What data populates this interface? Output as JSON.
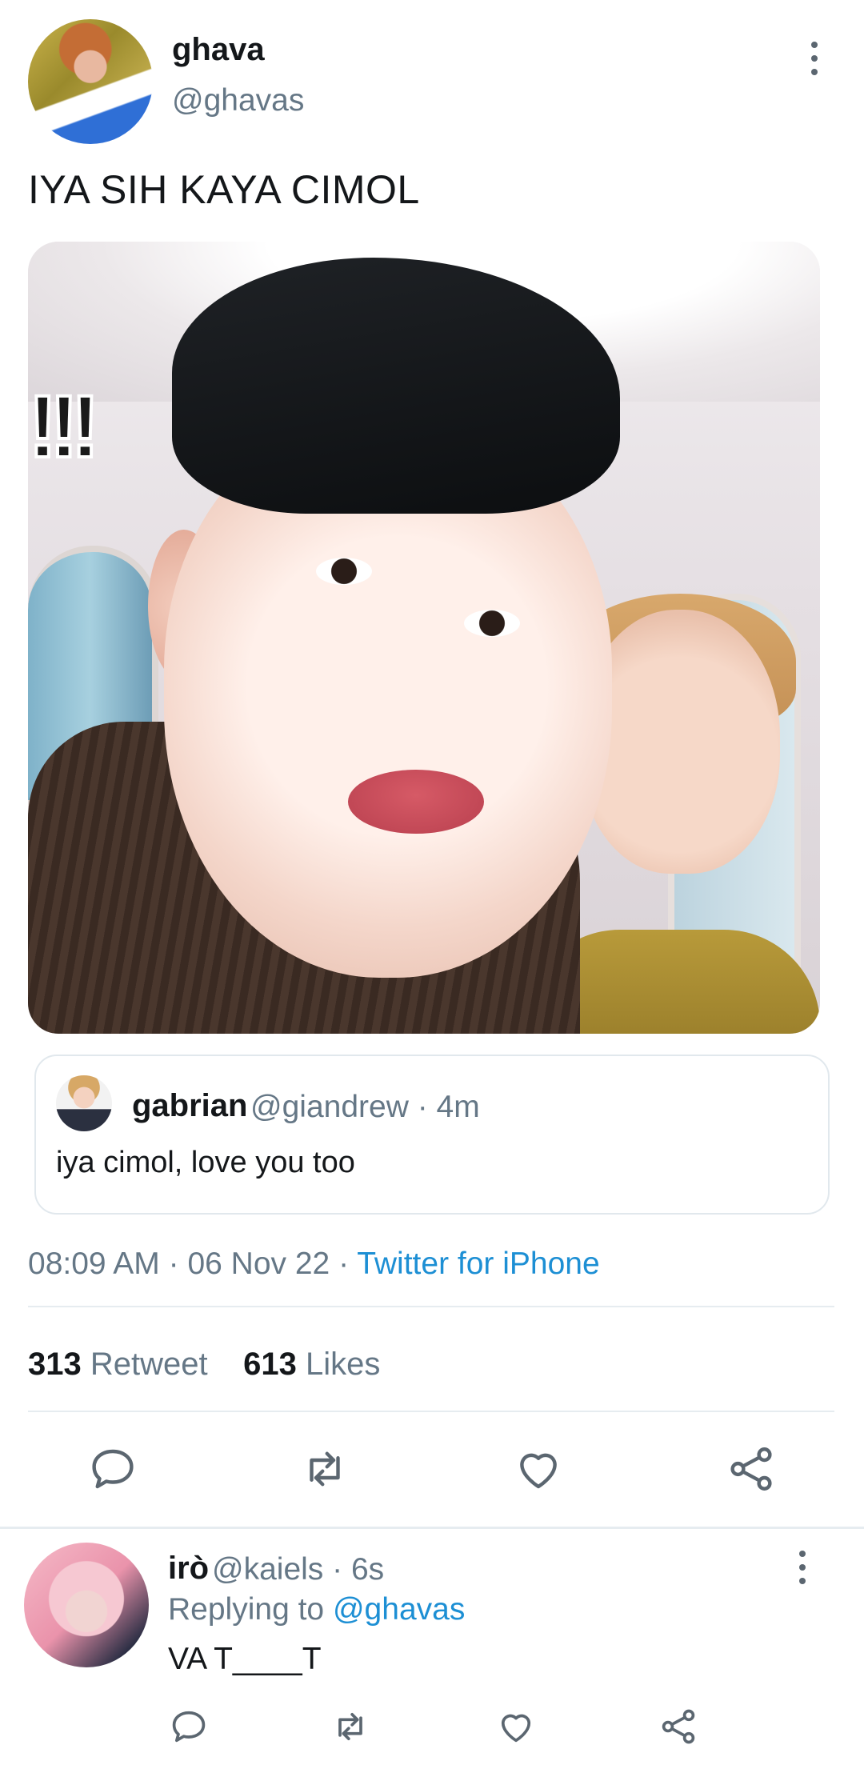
{
  "tweet": {
    "author_name": "ghava",
    "author_handle": "@ghavas",
    "text": "IYA SIH KAYA CIMOL",
    "media_overlay_text": "!!!"
  },
  "quoted": {
    "name": "gabrian",
    "handle_time": "@giandrew · 4m",
    "text": "iya cimol, love you too"
  },
  "meta": {
    "time": "08:09 AM",
    "sep1": " · ",
    "date": "06 Nov 22",
    "sep2": " · ",
    "source": "Twitter for iPhone"
  },
  "stats": {
    "retweets_count": "313",
    "retweets_label": "Retweet",
    "likes_count": "613",
    "likes_label": "Likes"
  },
  "reply": {
    "name": "irò",
    "handle_time": "@kaiels · 6s",
    "replying_prefix": "Replying to",
    "replying_handle": "@ghavas",
    "text": "VA T____T"
  },
  "icons": [
    "more-icon",
    "reply-icon",
    "retweet-icon",
    "like-icon",
    "share-icon"
  ],
  "colors": {
    "link": "#1d8fd4",
    "muted": "#657786",
    "text": "#14171a"
  }
}
